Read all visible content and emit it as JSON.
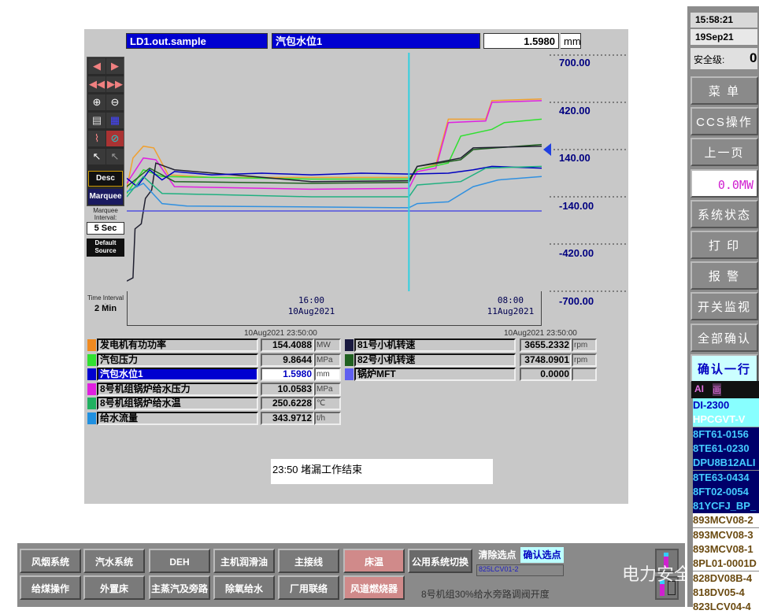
{
  "header": {
    "tag": "LD1.out.sample",
    "description": "汽包水位1",
    "value": "1.5980",
    "unit": "mm"
  },
  "toolbar": {
    "desc": "Desc",
    "marquee": "Marquee",
    "marquee_interval_label": "Marquee Interval:",
    "marquee_interval": "5 Sec",
    "default_source": "Default Source",
    "time_interval_label": "Time Interval :",
    "time_interval": "2 Min"
  },
  "chart_data": {
    "type": "line",
    "ylim": [
      -700,
      700
    ],
    "yticks": [
      "700.00",
      "420.00",
      "140.00",
      "-140.00",
      "-420.00",
      "-700.00"
    ],
    "xlim": [
      "2021-08-10T01:10",
      "2021-08-11T10:30"
    ],
    "xticks": [
      {
        "time": "16:00",
        "date": "10Aug2021",
        "at": "2021-08-10T16:00"
      },
      {
        "time": "08:00",
        "date": "11Aug2021",
        "at": "2021-08-11T08:00"
      }
    ],
    "cursor": "2021-08-10T23:50",
    "current_marker": 140,
    "series": [
      {
        "color": "#f0a030",
        "points": [
          [
            "2021-08-10T01:10",
            -90
          ],
          [
            "2021-08-10T01:40",
            90
          ],
          [
            "2021-08-10T02:30",
            160
          ],
          [
            "2021-08-10T03:20",
            150
          ],
          [
            "2021-08-10T04:30",
            -10
          ],
          [
            "2021-08-10T08:00",
            -25
          ],
          [
            "2021-08-10T16:00",
            -25
          ],
          [
            "2021-08-10T23:50",
            -25
          ],
          [
            "2021-08-11T00:30",
            20
          ],
          [
            "2021-08-11T02:00",
            50
          ],
          [
            "2021-08-11T03:00",
            320
          ],
          [
            "2021-08-11T06:00",
            320
          ],
          [
            "2021-08-11T06:30",
            430
          ],
          [
            "2021-08-11T10:30",
            440
          ]
        ]
      },
      {
        "color": "#e020e0",
        "points": [
          [
            "2021-08-10T01:10",
            -60
          ],
          [
            "2021-08-10T02:30",
            90
          ],
          [
            "2021-08-10T03:30",
            80
          ],
          [
            "2021-08-10T05:00",
            -80
          ],
          [
            "2021-08-10T16:00",
            -95
          ],
          [
            "2021-08-10T23:50",
            -90
          ],
          [
            "2021-08-11T00:30",
            10
          ],
          [
            "2021-08-11T02:00",
            30
          ],
          [
            "2021-08-11T03:00",
            300
          ],
          [
            "2021-08-11T06:00",
            310
          ],
          [
            "2021-08-11T06:30",
            420
          ],
          [
            "2021-08-11T10:30",
            430
          ]
        ]
      },
      {
        "color": "#30e030",
        "points": [
          [
            "2021-08-10T01:10",
            -120
          ],
          [
            "2021-08-10T02:30",
            20
          ],
          [
            "2021-08-10T04:00",
            -20
          ],
          [
            "2021-08-10T16:00",
            -35
          ],
          [
            "2021-08-10T23:50",
            -35
          ],
          [
            "2021-08-11T00:30",
            20
          ],
          [
            "2021-08-11T03:00",
            60
          ],
          [
            "2021-08-11T04:00",
            220
          ],
          [
            "2021-08-11T06:30",
            260
          ],
          [
            "2021-08-11T07:30",
            300
          ],
          [
            "2021-08-11T10:30",
            320
          ]
        ]
      },
      {
        "color": "#206020",
        "points": [
          [
            "2021-08-10T01:10",
            -80
          ],
          [
            "2021-08-10T03:00",
            30
          ],
          [
            "2021-08-10T05:00",
            -50
          ],
          [
            "2021-08-10T16:00",
            -60
          ],
          [
            "2021-08-10T23:50",
            -55
          ],
          [
            "2021-08-11T00:30",
            40
          ],
          [
            "2021-08-11T04:00",
            80
          ],
          [
            "2021-08-11T05:00",
            140
          ],
          [
            "2021-08-11T10:30",
            170
          ]
        ]
      },
      {
        "color": "#202030",
        "points": [
          [
            "2021-08-10T01:10",
            -640
          ],
          [
            "2021-08-10T01:40",
            -620
          ],
          [
            "2021-08-10T01:50",
            -330
          ],
          [
            "2021-08-10T02:20",
            -300
          ],
          [
            "2021-08-10T02:40",
            -150
          ],
          [
            "2021-08-10T03:10",
            -100
          ],
          [
            "2021-08-10T03:30",
            60
          ],
          [
            "2021-08-10T05:00",
            20
          ],
          [
            "2021-08-10T16:00",
            -50
          ],
          [
            "2021-08-10T23:50",
            -45
          ],
          [
            "2021-08-11T00:30",
            40
          ],
          [
            "2021-08-11T04:00",
            90
          ],
          [
            "2021-08-11T05:00",
            150
          ],
          [
            "2021-08-11T10:30",
            160
          ]
        ]
      },
      {
        "color": "#0000c0",
        "points": [
          [
            "2021-08-10T01:10",
            -30
          ],
          [
            "2021-08-10T02:00",
            -80
          ],
          [
            "2021-08-10T03:00",
            20
          ],
          [
            "2021-08-10T04:00",
            -40
          ],
          [
            "2021-08-10T05:00",
            10
          ],
          [
            "2021-08-10T08:00",
            -10
          ],
          [
            "2021-08-10T12:00",
            0
          ],
          [
            "2021-08-10T16:00",
            -10
          ],
          [
            "2021-08-10T20:00",
            0
          ],
          [
            "2021-08-10T23:50",
            -5
          ],
          [
            "2021-08-11T03:00",
            0
          ],
          [
            "2021-08-11T05:00",
            20
          ],
          [
            "2021-08-11T06:30",
            40
          ],
          [
            "2021-08-11T10:30",
            30
          ]
        ]
      },
      {
        "color": "#3090e0",
        "points": [
          [
            "2021-08-10T01:10",
            -110
          ],
          [
            "2021-08-10T02:30",
            -60
          ],
          [
            "2021-08-10T04:00",
            -180
          ],
          [
            "2021-08-10T06:00",
            -195
          ],
          [
            "2021-08-10T16:00",
            -200
          ],
          [
            "2021-08-10T23:50",
            -205
          ],
          [
            "2021-08-11T00:30",
            -180
          ],
          [
            "2021-08-11T03:00",
            -170
          ],
          [
            "2021-08-11T05:00",
            -80
          ],
          [
            "2021-08-11T07:00",
            -40
          ],
          [
            "2021-08-11T10:30",
            -20
          ]
        ]
      },
      {
        "color": "#20b080",
        "points": [
          [
            "2021-08-10T01:10",
            -140
          ],
          [
            "2021-08-10T02:30",
            -20
          ],
          [
            "2021-08-10T04:00",
            -120
          ],
          [
            "2021-08-10T16:00",
            -140
          ],
          [
            "2021-08-10T23:50",
            -140
          ],
          [
            "2021-08-11T00:30",
            -70
          ],
          [
            "2021-08-11T04:00",
            -50
          ],
          [
            "2021-08-11T06:00",
            30
          ],
          [
            "2021-08-11T10:30",
            40
          ]
        ]
      },
      {
        "color": "#5050e0",
        "points": [
          [
            "2021-08-10T01:10",
            -224
          ],
          [
            "2021-08-11T10:30",
            -224
          ]
        ]
      }
    ]
  },
  "table": {
    "timestamp_left": "10Aug2021  23:50:00",
    "timestamp_right": "10Aug2021  23:50:00",
    "left": [
      {
        "name": "发电机有功功率",
        "value": "154.4088",
        "unit": "MW",
        "color": "#f08a20"
      },
      {
        "name": "汽包压力",
        "value": "9.8644",
        "unit": "MPa",
        "color": "#30e030"
      },
      {
        "name": "汽包水位1",
        "value": "1.5980",
        "unit": "mm",
        "color": "#0000d0",
        "selected": true
      },
      {
        "name": "8号机组锅炉给水压力",
        "value": "10.0583",
        "unit": "MPa",
        "color": "#e020e0"
      },
      {
        "name": "8号机组锅炉给水温",
        "value": "250.6228",
        "unit": "℃",
        "color": "#20b060"
      },
      {
        "name": "给水流量",
        "value": "343.9712",
        "unit": "t/h",
        "color": "#2090e0"
      }
    ],
    "right": [
      {
        "name": "81号小机转速",
        "value": "3655.2332",
        "unit": "rpm",
        "color": "#1a1a40"
      },
      {
        "name": "82号小机转速",
        "value": "3748.0901",
        "unit": "rpm",
        "color": "#206020"
      },
      {
        "name": "锅炉MFT",
        "value": "0.0000",
        "unit": "",
        "color": "#6060f0"
      }
    ]
  },
  "message": "23:50  堵漏工作结束",
  "bottom": {
    "row1": [
      "风烟系统",
      "汽水系统",
      "DEH",
      "主机润滑油",
      "主接线",
      "床温",
      "公用系统切换"
    ],
    "row2": [
      "给煤操作",
      "外置床",
      "主蒸汽及旁路",
      "除氧给水",
      "厂用联络",
      "风道燃烧器"
    ],
    "clear_point": "清除选点",
    "confirm_point": "确认选点",
    "selected_point": "825LCV01-2",
    "point_desc": "8号机组30%给水旁路调阀开度"
  },
  "side": {
    "time": "15:58:21",
    "date": "19Sep21",
    "safety_label": "安全级:",
    "safety_value": "0",
    "menu": [
      "菜 单",
      "CCS操作",
      "上一页",
      "0.0MW",
      "系统状态",
      "打 印",
      "报 警",
      "开关监视",
      "全部确认",
      "确认一行"
    ],
    "alarm_header": [
      "AI",
      "画"
    ],
    "alarms": [
      {
        "text": "DI-2300",
        "style": "sel"
      },
      {
        "text": "HPCGVT-V",
        "style": "sel2"
      },
      {
        "text": "8FT61-0156",
        "style": "new"
      },
      {
        "text": "8TE61-0230",
        "style": "new"
      },
      {
        "text": "DPU8B12ALI",
        "style": "new"
      },
      {
        "text": "8TE63-0434",
        "style": "new"
      },
      {
        "text": "8FT02-0054",
        "style": "new"
      },
      {
        "text": "81YCFJ_BP_",
        "style": "new"
      },
      {
        "text": "893MCV08-2",
        "style": "ack"
      },
      {
        "text": "893MCV08-3",
        "style": "ack"
      },
      {
        "text": "893MCV08-1",
        "style": "ack"
      },
      {
        "text": "8PL01-0001D",
        "style": "ack"
      },
      {
        "text": "828DV08B-4",
        "style": "ack"
      },
      {
        "text": "818DV05-4",
        "style": "ack"
      },
      {
        "text": "823LCV04-4",
        "style": "ack"
      }
    ]
  },
  "watermark": "电力安全生产"
}
